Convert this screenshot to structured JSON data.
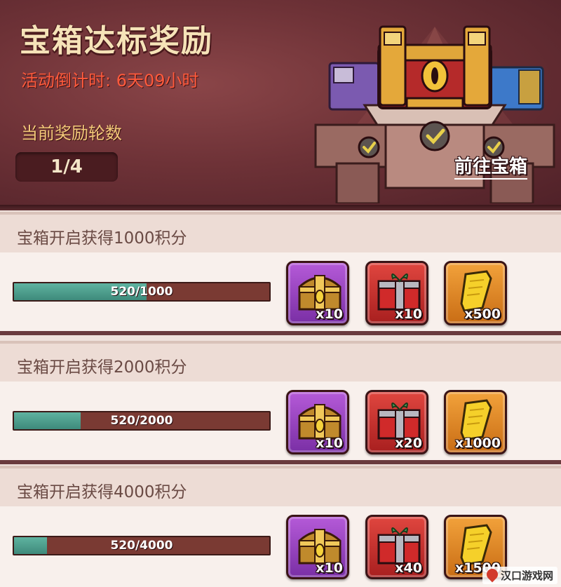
{
  "header": {
    "title": "宝箱达标奖励",
    "countdown": "活动倒计时: 6天09小时",
    "rounds_label": "当前奖励轮数",
    "rounds_value": "1/4",
    "goto_button": "前往宝箱"
  },
  "tiers": [
    {
      "title": "宝箱开启获得1000积分",
      "progress_text": "520/1000",
      "progress_fraction": 0.52,
      "rewards": [
        {
          "icon": "golden-chest-icon",
          "qty": "x10"
        },
        {
          "icon": "gift-box-icon",
          "qty": "x10"
        },
        {
          "icon": "scroll-icon",
          "qty": "x500"
        }
      ]
    },
    {
      "title": "宝箱开启获得2000积分",
      "progress_text": "520/2000",
      "progress_fraction": 0.26,
      "rewards": [
        {
          "icon": "golden-chest-icon",
          "qty": "x10"
        },
        {
          "icon": "gift-box-icon",
          "qty": "x20"
        },
        {
          "icon": "scroll-icon",
          "qty": "x1000"
        }
      ]
    },
    {
      "title": "宝箱开启获得4000积分",
      "progress_text": "520/4000",
      "progress_fraction": 0.13,
      "rewards": [
        {
          "icon": "golden-chest-icon",
          "qty": "x10"
        },
        {
          "icon": "gift-box-icon",
          "qty": "x40"
        },
        {
          "icon": "scroll-icon",
          "qty": "x1500"
        }
      ]
    }
  ],
  "watermark": "汉口游戏网"
}
